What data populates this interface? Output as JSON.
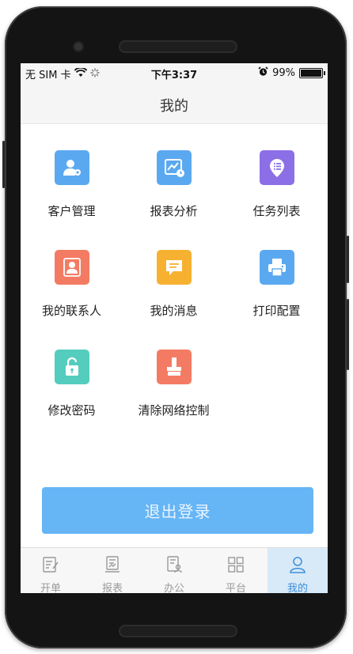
{
  "statusbar": {
    "carrier": "无 SIM 卡",
    "time": "下午3:37",
    "battery": "99%",
    "battery_level": 0.99
  },
  "header": {
    "title": "我的"
  },
  "menu": [
    {
      "label": "客户管理",
      "icon": "customer-management-icon",
      "color": "#5aa9f0"
    },
    {
      "label": "报表分析",
      "icon": "report-analysis-icon",
      "color": "#5aa9f0"
    },
    {
      "label": "任务列表",
      "icon": "task-list-icon",
      "color": "#8c6fe6"
    },
    {
      "label": "我的联系人",
      "icon": "contact-icon",
      "color": "#f47b63"
    },
    {
      "label": "我的消息",
      "icon": "message-icon",
      "color": "#f7b131"
    },
    {
      "label": "打印配置",
      "icon": "printer-icon",
      "color": "#5aa9f0"
    },
    {
      "label": "修改密码",
      "icon": "unlock-icon",
      "color": "#55cdbe"
    },
    {
      "label": "清除网络控制",
      "icon": "clear-icon",
      "color": "#f47b63"
    }
  ],
  "logout_label": "退出登录",
  "colors": {
    "accent": "#66b5f5",
    "active_tab": "#3c8fd8"
  },
  "tabs": [
    {
      "label": "开单",
      "icon": "order-icon"
    },
    {
      "label": "报表",
      "icon": "report-icon"
    },
    {
      "label": "办公",
      "icon": "office-icon"
    },
    {
      "label": "平台",
      "icon": "grid-icon"
    },
    {
      "label": "我的",
      "icon": "user-icon",
      "active": true
    }
  ]
}
